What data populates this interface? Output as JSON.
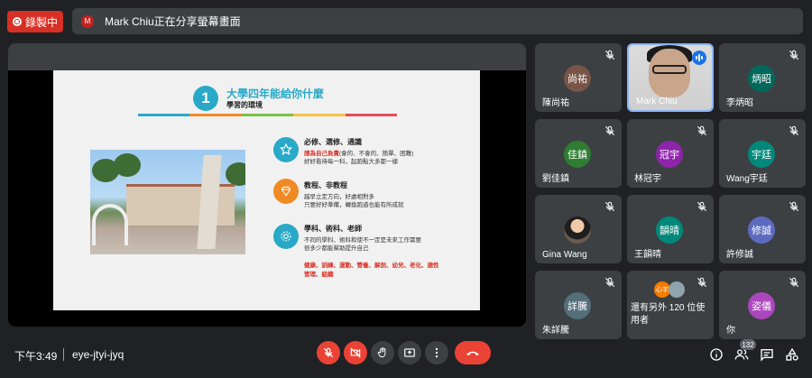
{
  "recording": {
    "label": "錄製中"
  },
  "share_banner": {
    "avatar_initial": "M",
    "text": "Mark Chiu正在分享螢幕畫面"
  },
  "slide": {
    "number": "1",
    "title": "大學四年能給你什麼",
    "subtitle": "學習的環境",
    "color_bar": [
      "#29a9c7",
      "#f08a24",
      "#7bc143",
      "#f6c343",
      "#e84d5b"
    ],
    "features": [
      {
        "icon": "star-icon",
        "color": "#29a9c7",
        "title": "必修、選修、通識",
        "lines": [
          {
            "red": "請為自己負責",
            "rest": "(會的、不會的、簡單、困難)"
          },
          {
            "red": "",
            "rest": "好好看待每一科，起跑點大多都一樣"
          }
        ]
      },
      {
        "icon": "diamond-icon",
        "color": "#f08a24",
        "title": "教程、非教程",
        "lines": [
          {
            "red": "",
            "rest": "越早立定方向，好處相對多"
          },
          {
            "red": "",
            "rest": "只要好好準備，轉換跑道也能有所成就"
          }
        ]
      },
      {
        "icon": "gear-icon",
        "color": "#29a9c7",
        "title": "學科、術科、老師",
        "lines": [
          {
            "red": "",
            "rest": "不同的學科、術科和使不一定是未來工作需要"
          },
          {
            "red": "",
            "rest": "很多少都能幫助提升自己"
          }
        ]
      }
    ],
    "red_note_1": "健康、訓練、運動、營養、解剖、幼兒、老化、適性",
    "red_note_2": "管理、組織"
  },
  "participants": [
    {
      "name": "陳尚祐",
      "initials": "尚祐",
      "color": "#795548"
    },
    {
      "name": "Mark Chiu",
      "video": true
    },
    {
      "name": "李炳昭",
      "initials": "炳昭",
      "color": "#00695c"
    },
    {
      "name": "劉佳鎮",
      "initials": "佳鎮",
      "color": "#2e7d32"
    },
    {
      "name": "林冠宇",
      "initials": "冠宇",
      "color": "#8e24aa"
    },
    {
      "name": "Wang宇廷",
      "initials": "宇廷",
      "color": "#00897b"
    },
    {
      "name": "Gina Wang",
      "photo": true
    },
    {
      "name": "王韻晴",
      "initials": "韻晴",
      "color": "#00897b"
    },
    {
      "name": "許修誠",
      "initials": "修誠",
      "color": "#5c6bc0"
    },
    {
      "name": "朱詳騰",
      "initials": "詳騰",
      "color": "#546e7a"
    },
    {
      "name": "others",
      "text": "還有另外 120 位使用者",
      "small_initials": "心宇"
    },
    {
      "name": "你",
      "initials": "姿儀",
      "color": "#ab47bc"
    }
  ],
  "bottom_bar": {
    "time": "下午3:49",
    "meeting_code": "eye-jtyi-jyq",
    "people_count": "132"
  }
}
